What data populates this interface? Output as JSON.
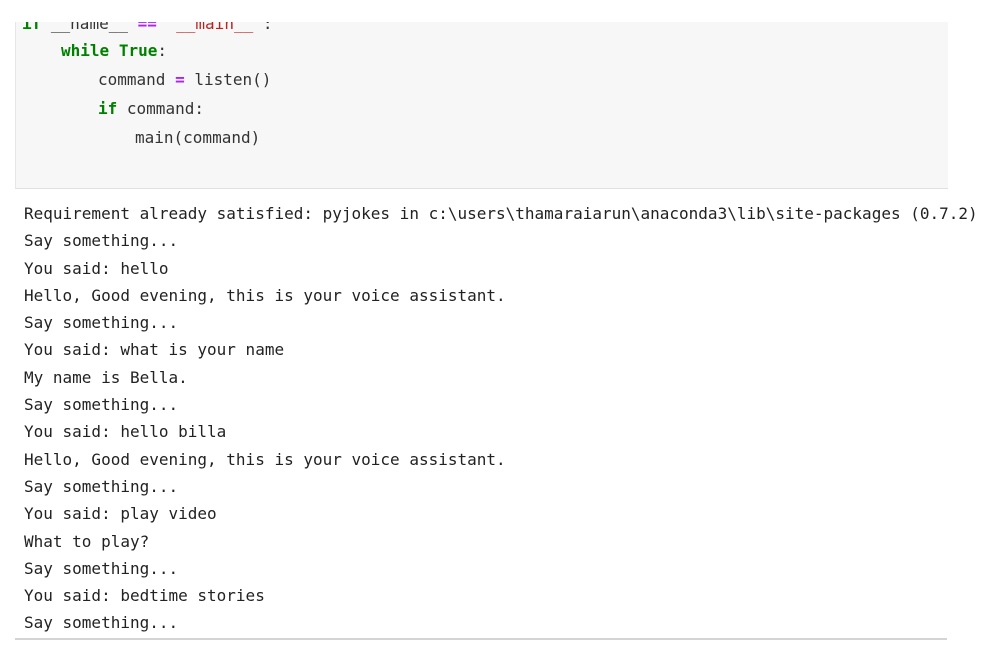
{
  "code_cell": {
    "line0": {
      "kw_if": "if",
      "name_var": "__name__",
      "op_eq": "==",
      "main_str": "'__main__'",
      "colon": ":"
    },
    "line1": {
      "kw_while": "while",
      "kw_true": "True",
      "colon": ":"
    },
    "line2": {
      "var": "command",
      "op_assign": "=",
      "call": "listen()"
    },
    "line3": {
      "kw_if": "if",
      "rest": "command:"
    },
    "line4": {
      "call": "main(command)"
    }
  },
  "output": {
    "lines": [
      "Requirement already satisfied: pyjokes in c:\\users\\thamaraiarun\\anaconda3\\lib\\site-packages (0.7.2)",
      "Say something...",
      "You said: hello",
      "Hello, Good evening, this is your voice assistant.",
      "Say something...",
      "You said: what is your name",
      "My name is Bella.",
      "Say something...",
      "You said: hello billa",
      "Hello, Good evening, this is your voice assistant.",
      "Say something...",
      "You said: play video",
      "What to play?",
      "Say something...",
      "You said: bedtime stories",
      "Say something..."
    ]
  }
}
